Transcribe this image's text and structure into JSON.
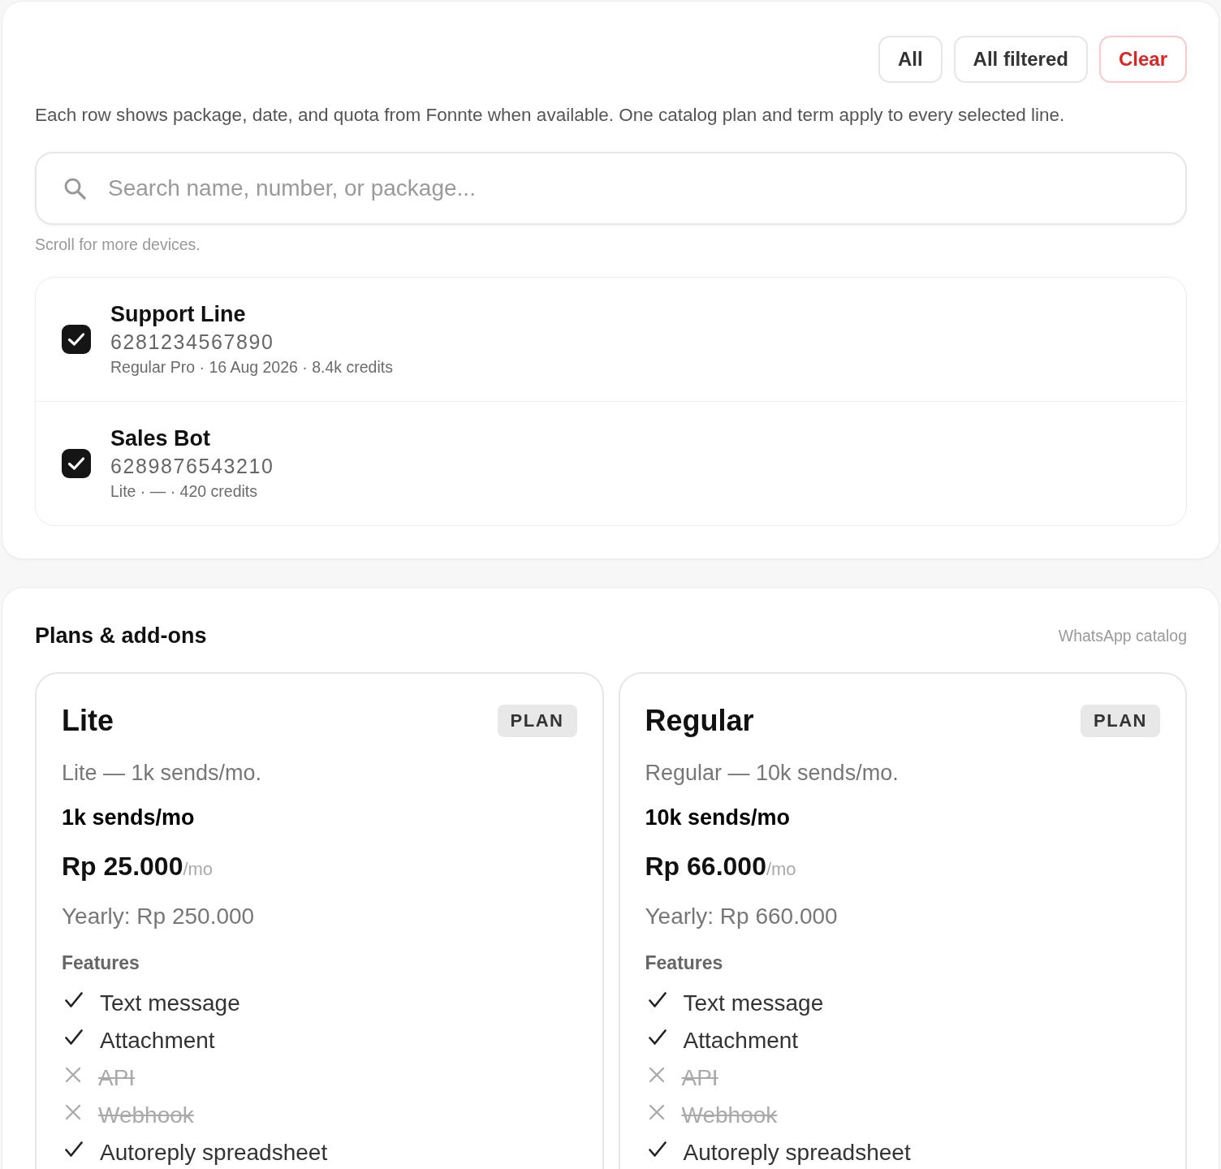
{
  "device_selection": {
    "buttons": [
      {
        "label": "All",
        "kind": "default"
      },
      {
        "label": "All filtered",
        "kind": "default"
      },
      {
        "label": "Clear",
        "kind": "danger"
      }
    ],
    "description": "Each row shows package, date, and quota from Fonnte when available. One catalog plan and term apply to every selected line.",
    "search": {
      "placeholder": "Search name, number, or package..."
    },
    "hint": "Scroll for more devices.",
    "devices": [
      {
        "name": "Support Line",
        "number": "6281234567890",
        "details": "Regular Pro · 16 Aug 2026 · 8.4k credits",
        "checked": true
      },
      {
        "name": "Sales Bot",
        "number": "6289876543210",
        "details": "Lite · — · 420 credits",
        "checked": true
      }
    ]
  },
  "plans_section": {
    "title": "Plans & add-ons",
    "subtitle": "WhatsApp catalog",
    "plans": [
      {
        "name": "Lite",
        "badge": "PLAN",
        "description": "Lite — 1k sends/mo.",
        "quota": "1k sends/mo",
        "price": "Rp 25.000",
        "period": "/mo",
        "yearly": "Yearly: Rp 250.000",
        "features_title": "Features",
        "features": [
          {
            "label": "Text message",
            "included": true
          },
          {
            "label": "Attachment",
            "included": true
          },
          {
            "label": "API",
            "included": false
          },
          {
            "label": "Webhook",
            "included": false
          },
          {
            "label": "Autoreply spreadsheet",
            "included": true
          }
        ]
      },
      {
        "name": "Regular",
        "badge": "PLAN",
        "description": "Regular — 10k sends/mo.",
        "quota": "10k sends/mo",
        "price": "Rp 66.000",
        "period": "/mo",
        "yearly": "Yearly: Rp 660.000",
        "features_title": "Features",
        "features": [
          {
            "label": "Text message",
            "included": true
          },
          {
            "label": "Attachment",
            "included": true
          },
          {
            "label": "API",
            "included": false
          },
          {
            "label": "Webhook",
            "included": false
          },
          {
            "label": "Autoreply spreadsheet",
            "included": true
          }
        ]
      }
    ]
  }
}
